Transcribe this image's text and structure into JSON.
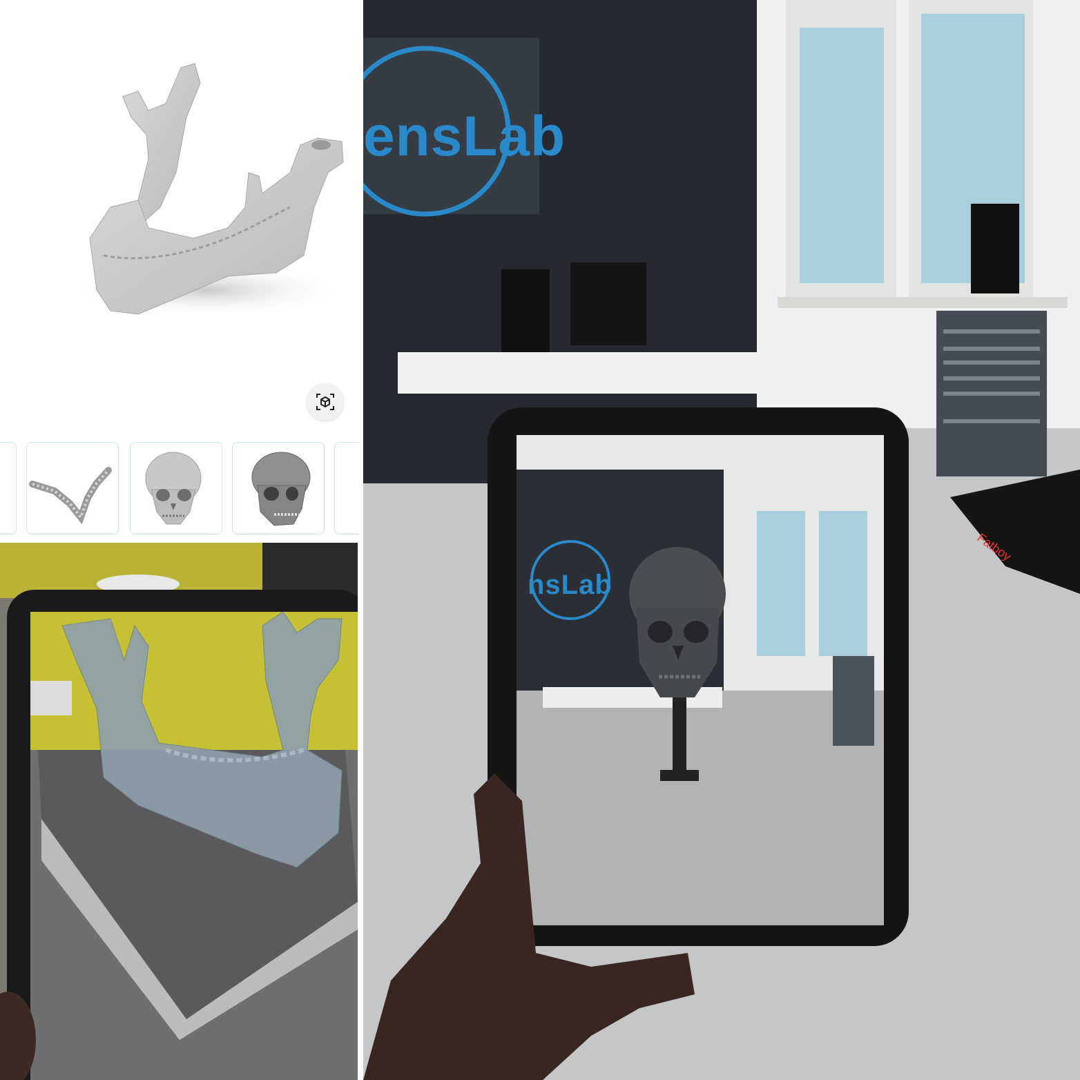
{
  "viewer": {
    "model": "mandible-3d-model",
    "ar_button_icon": "ar-cube-icon"
  },
  "thumbnails": [
    {
      "name": "partial-model-thumb"
    },
    {
      "name": "teeth-arch-thumb"
    },
    {
      "name": "skull-front-thumb"
    },
    {
      "name": "skull-dark-thumb"
    },
    {
      "name": "partial-model-thumb-2"
    }
  ],
  "right_scene": {
    "wall_sign": "ensLab",
    "tablet_sign": "nsLab",
    "beanbag_label": "Fatboy"
  },
  "colors": {
    "accent": "#2a89c9",
    "thumb_border": "#cde6ee",
    "wall": "#262a30"
  }
}
